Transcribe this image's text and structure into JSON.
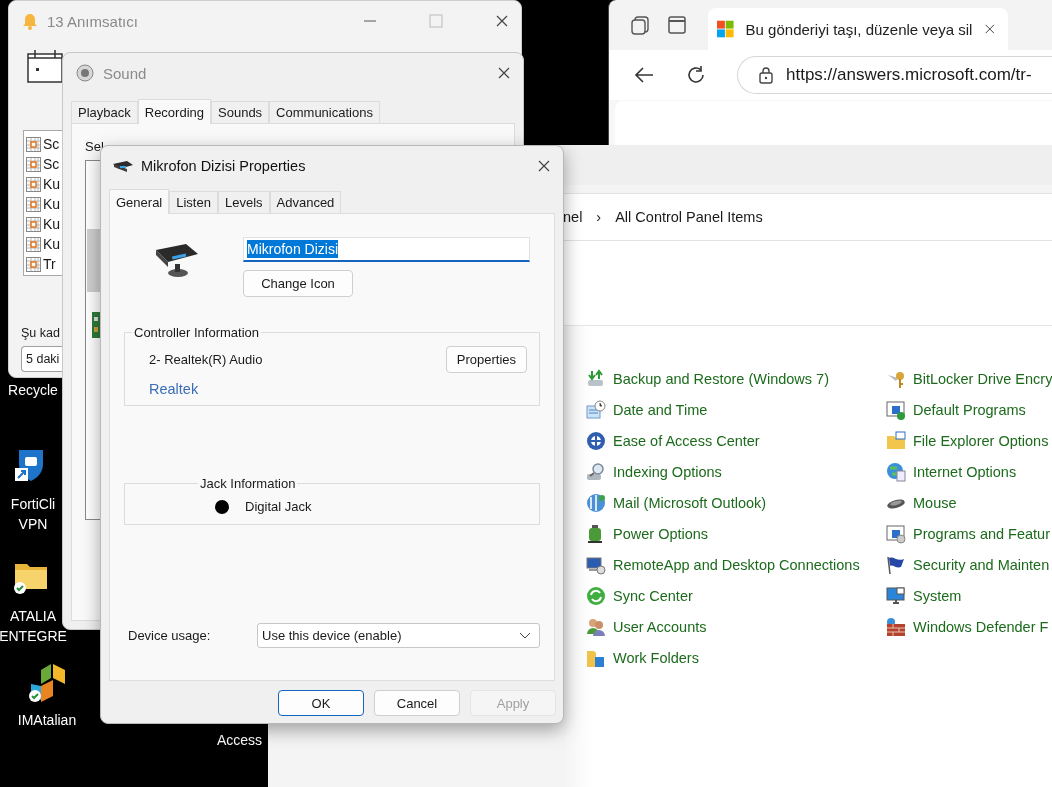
{
  "desktop": {
    "icons": [
      {
        "kind": "hidden",
        "label": [
          "Recycle"
        ]
      },
      {
        "kind": "shield",
        "label": [
          "FortiCli",
          "VPN"
        ]
      },
      {
        "kind": "folder",
        "label": [
          "ATALIA",
          "ENTEGRE"
        ]
      },
      {
        "kind": "blocks",
        "label": [
          "IMAtalian"
        ]
      },
      {
        "kind": "hidden",
        "label": [
          "Access"
        ]
      }
    ]
  },
  "browser": {
    "tab_title": "Bu gönderiyi taşı, düzenle veya sil",
    "address": "https://answers.microsoft.com/tr-"
  },
  "control_panel": {
    "breadcrumb": [
      "nel",
      "All Control Panel Items"
    ],
    "separator": "›",
    "columns": [
      [
        "Backup and Restore (Windows 7)",
        "Date and Time",
        "Ease of Access Center",
        "Indexing Options",
        "Mail (Microsoft Outlook)",
        "Power Options",
        "RemoteApp and Desktop Connections",
        "Sync Center",
        "User Accounts",
        "Work Folders"
      ],
      [
        "BitLocker Drive Encry",
        "Default Programs",
        "File Explorer Options",
        "Internet Options",
        "Mouse",
        "Programs and Featur",
        "Security and Mainten",
        "System",
        "Windows Defender F"
      ]
    ]
  },
  "reminder_window": {
    "title": "13 Anımsatıcı",
    "items": [
      "Sc",
      "Sc",
      "Ku",
      "Ku",
      "Ku",
      "Ku",
      "Tr"
    ],
    "snooze_label": "Şu kad",
    "snooze_value": "5 daki"
  },
  "sound_window": {
    "title": "Sound",
    "tabs": [
      {
        "label": "Playback",
        "selected": false
      },
      {
        "label": "Recording",
        "selected": true
      },
      {
        "label": "Sounds",
        "selected": false
      },
      {
        "label": "Communications",
        "selected": false
      }
    ],
    "instruction": "Sel"
  },
  "properties_dialog": {
    "title": "Mikrofon Dizisi Properties",
    "tabs": [
      {
        "label": "General",
        "selected": true
      },
      {
        "label": "Listen",
        "selected": false
      },
      {
        "label": "Levels",
        "selected": false
      },
      {
        "label": "Advanced",
        "selected": false
      }
    ],
    "name_field": {
      "value": "Mikrofon Dizisi",
      "selected": true
    },
    "change_icon_button": "Change Icon",
    "controller": {
      "legend": "Controller Information",
      "name": "2- Realtek(R) Audio",
      "properties_button": "Properties",
      "vendor_link": "Realtek"
    },
    "jack": {
      "legend": "Jack Information",
      "jacks": [
        {
          "label": "Digital Jack",
          "color": "#000000"
        }
      ]
    },
    "device_usage": {
      "label": "Device usage:",
      "value": "Use this device (enable)"
    },
    "buttons": [
      {
        "label": "OK",
        "default": true,
        "disabled": false
      },
      {
        "label": "Cancel",
        "default": false,
        "disabled": false
      },
      {
        "label": "Apply",
        "default": false,
        "disabled": true
      }
    ]
  }
}
